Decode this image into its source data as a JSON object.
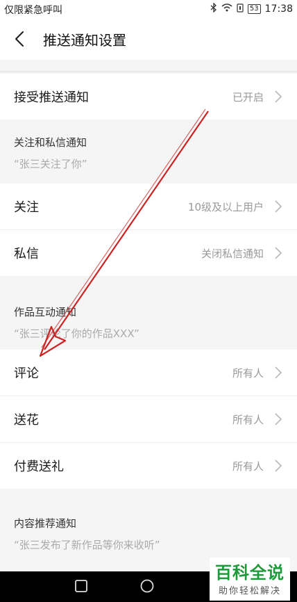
{
  "status_bar": {
    "left_text": "仅限紧急呼叫",
    "battery": "53",
    "time": "17:38"
  },
  "header": {
    "title": "推送通知设置",
    "back_icon": "chevron-left-icon"
  },
  "push_toggle": {
    "label": "接受推送通知",
    "value": "已开启"
  },
  "sections": {
    "follow_msg": {
      "title": "关注和私信通知",
      "example": "“张三关注了你”",
      "rows": [
        {
          "label": "关注",
          "value": "10级及以上用户"
        },
        {
          "label": "私信",
          "value": "关闭私信通知"
        }
      ]
    },
    "works": {
      "title": "作品互动通知",
      "example": "“张三评论了你的作品XXX”",
      "rows": [
        {
          "label": "评论",
          "value": "所有人"
        },
        {
          "label": "送花",
          "value": "所有人"
        },
        {
          "label": "付费送礼",
          "value": "所有人"
        }
      ]
    },
    "recommend": {
      "title": "内容推荐通知",
      "example": "“张三发布了新作品等你来收听”"
    }
  },
  "watermark": {
    "main": "百科全说",
    "sub": "助你轻松解决"
  },
  "colors": {
    "arrow": "#cc2222",
    "watermark_green": "#1f9a3a"
  }
}
